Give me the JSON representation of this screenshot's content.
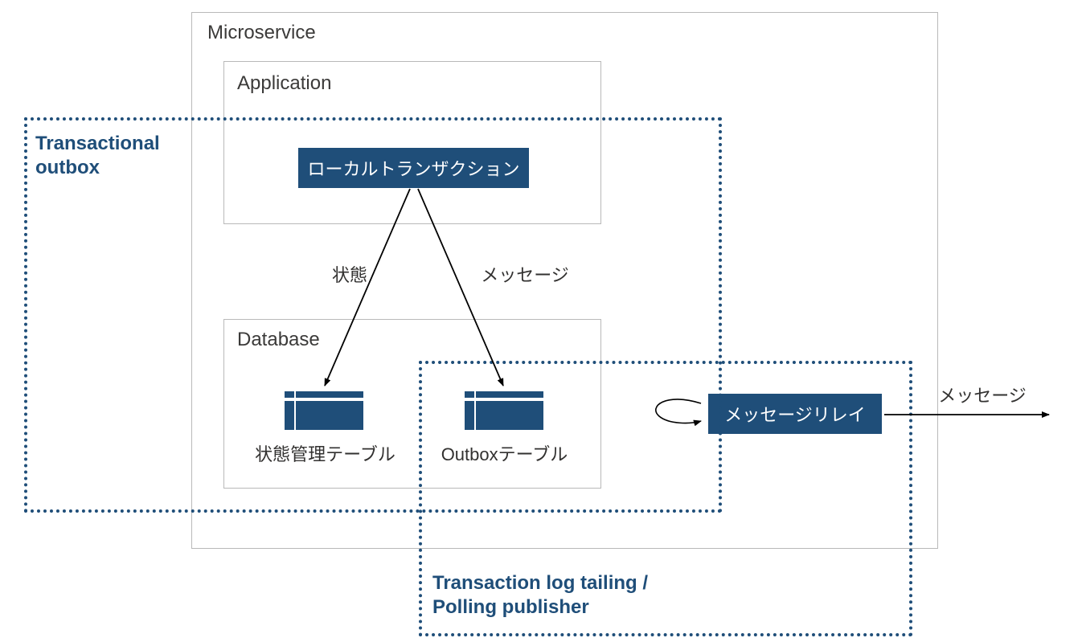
{
  "microservice": {
    "title": "Microservice"
  },
  "application": {
    "title": "Application",
    "local_transaction": "ローカルトランザクション"
  },
  "database": {
    "title": "Database",
    "state_table_label": "状態管理テーブル",
    "outbox_table_label": "Outboxテーブル"
  },
  "regions": {
    "transactional_outbox": "Transactional\noutbox",
    "log_tailing": "Transaction log tailing /\nPolling publisher"
  },
  "arrows": {
    "state_label": "状態",
    "message_label": "メッセージ",
    "out_message_label": "メッセージ"
  },
  "relay": {
    "label": "メッセージリレイ"
  }
}
